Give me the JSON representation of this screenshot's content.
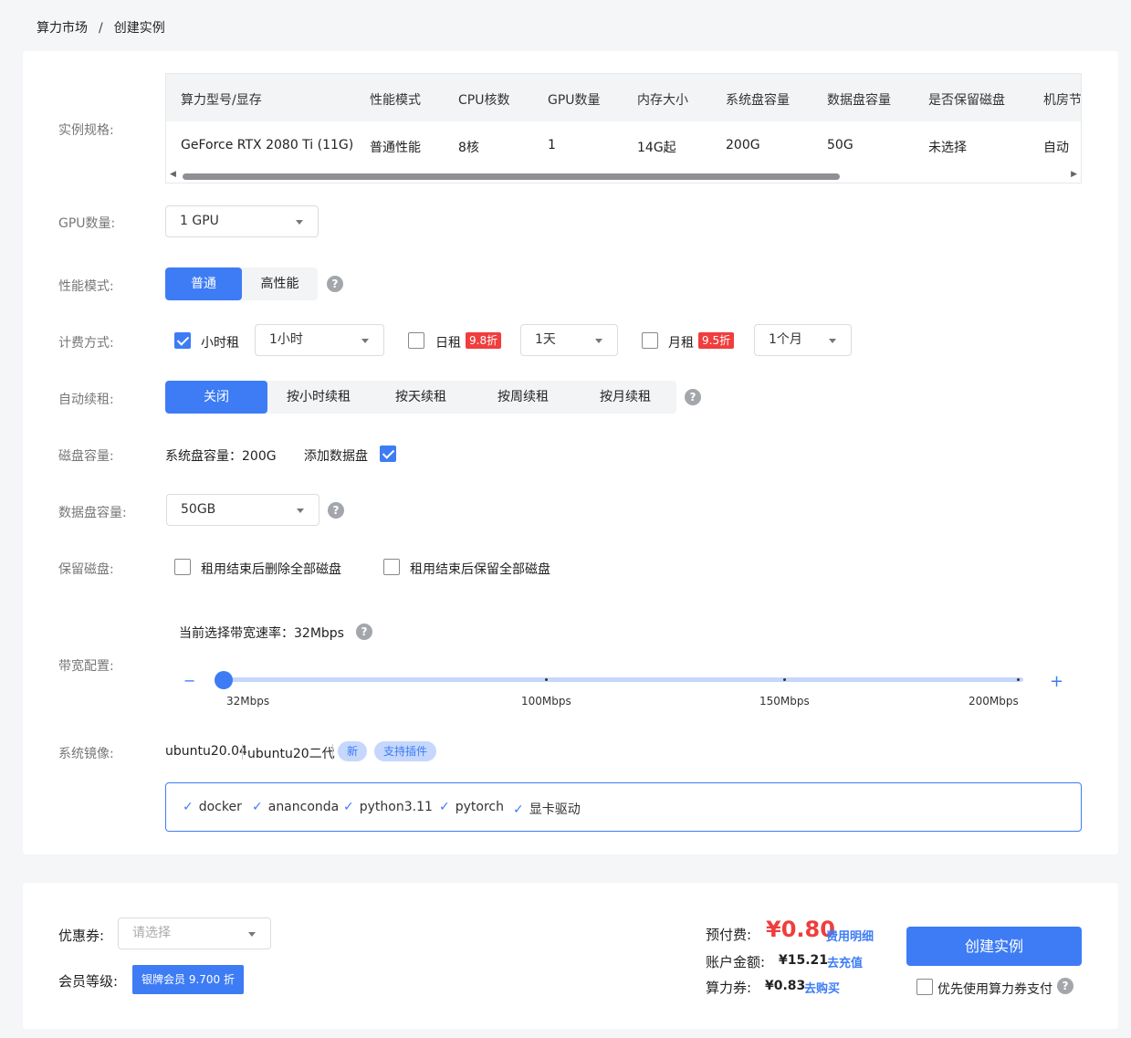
{
  "breadcrumb": {
    "root": "算力市场",
    "separator": "/",
    "current": "创建实例"
  },
  "spec": {
    "label": "实例规格:",
    "headers": [
      "算力型号/显存",
      "性能模式",
      "CPU核数",
      "GPU数量",
      "内存大小",
      "系统盘容量",
      "数据盘容量",
      "是否保留磁盘",
      "机房节"
    ],
    "row": [
      "GeForce RTX 2080 Ti (11G)",
      "普通性能",
      "8核",
      "1",
      "14G起",
      "200G",
      "50G",
      "未选择",
      "自动"
    ]
  },
  "gpu_count": {
    "label": "GPU数量:",
    "value": "1 GPU"
  },
  "perf_mode": {
    "label": "性能模式:",
    "options": [
      "普通",
      "高性能"
    ],
    "selected": "普通"
  },
  "billing": {
    "label": "计费方式:",
    "hourly": {
      "label": "小时租",
      "checked": true,
      "select": "1小时"
    },
    "daily": {
      "label": "日租",
      "discount": "9.8折",
      "checked": false,
      "select": "1天"
    },
    "monthly": {
      "label": "月租",
      "discount": "9.5折",
      "checked": false,
      "select": "1个月"
    }
  },
  "auto_renew": {
    "label": "自动续租:",
    "options": [
      "关闭",
      "按小时续租",
      "按天续租",
      "按周续租",
      "按月续租"
    ],
    "selected": "关闭"
  },
  "disk": {
    "label": "磁盘容量:",
    "system": "系统盘容量：200G",
    "add_data_disk": "添加数据盘",
    "add_checked": true
  },
  "data_disk": {
    "label": "数据盘容量:",
    "value": "50GB"
  },
  "keep_disk": {
    "label": "保留磁盘:",
    "options": [
      "租用结束后删除全部磁盘",
      "租用结束后保留全部磁盘"
    ]
  },
  "bandwidth": {
    "label": "带宽配置:",
    "current": "当前选择带宽速率：32Mbps",
    "minus": "−",
    "plus": "+",
    "ticks": [
      "32Mbps",
      "100Mbps",
      "150Mbps",
      "200Mbps"
    ],
    "value": 32,
    "min": 32,
    "max": 200
  },
  "image": {
    "label": "系统镜像:",
    "os": "ubuntu20.04",
    "name": "ubuntu20二代",
    "badge_new": "新",
    "badge_plugin": "支持插件",
    "tags": [
      "docker",
      "ananconda",
      "python3.11",
      "pytorch",
      "显卡驱动"
    ]
  },
  "footer": {
    "coupon_label": "优惠券:",
    "coupon_placeholder": "请选择",
    "member_label": "会员等级:",
    "member_badge": "银牌会员 9.700 折",
    "prepay_label": "预付费:",
    "prepay_value": "¥0.80",
    "fee_detail": "费用明细",
    "balance_label": "账户金额:",
    "balance_value": "¥15.21",
    "recharge": "去充值",
    "voucher_label": "算力券:",
    "voucher_value": "¥0.83",
    "buy": "去购买",
    "create_button": "创建实例",
    "prefer_voucher": "优先使用算力券支付"
  },
  "colors": {
    "primary": "#3d7cf5",
    "danger": "#f03d3d"
  }
}
